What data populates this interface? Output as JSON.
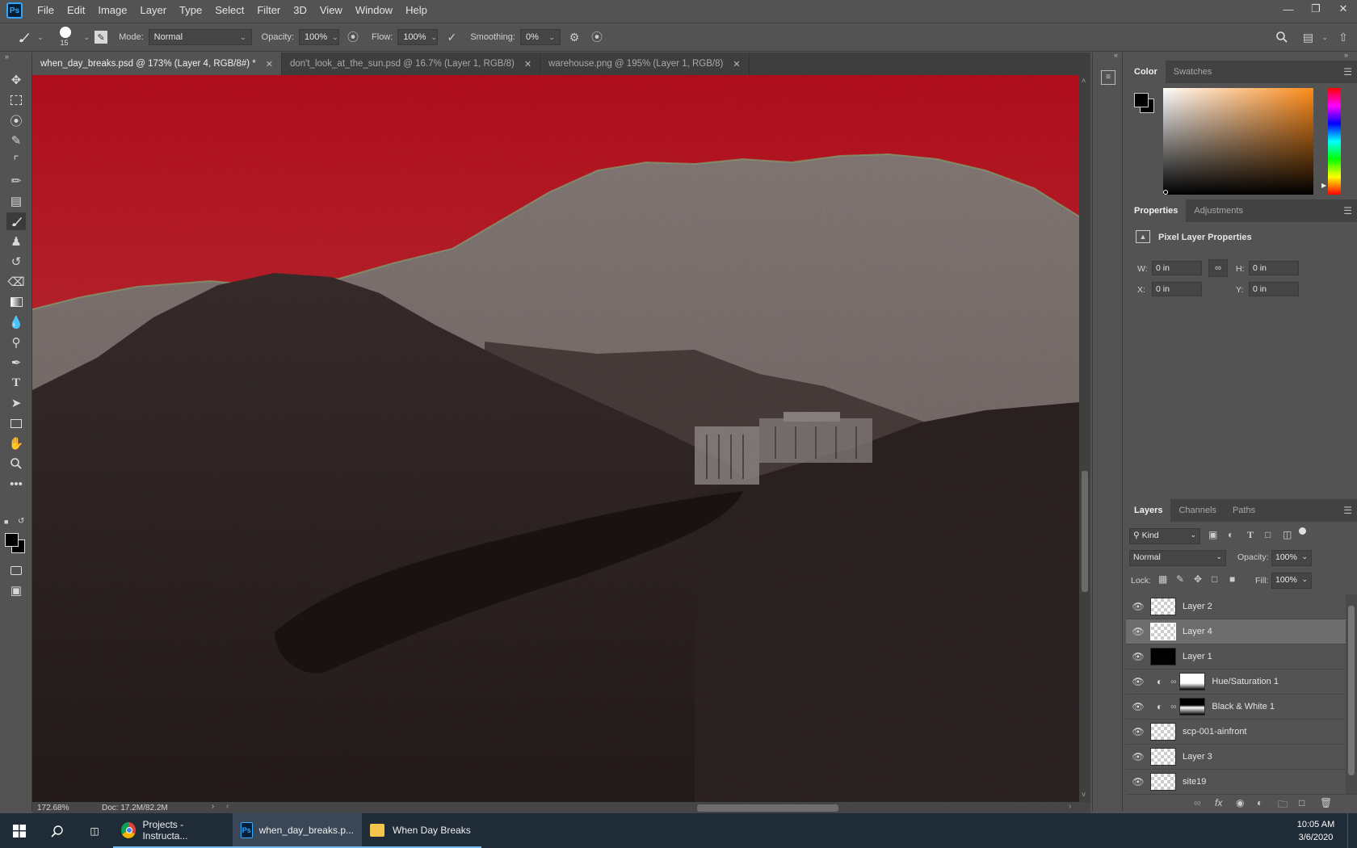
{
  "app": {
    "name": "Photoshop",
    "logo_text": "Ps"
  },
  "menu": [
    "File",
    "Edit",
    "Image",
    "Layer",
    "Type",
    "Select",
    "Filter",
    "3D",
    "View",
    "Window",
    "Help"
  ],
  "options": {
    "brush_size": "15",
    "mode_label": "Mode:",
    "mode_value": "Normal",
    "opacity_label": "Opacity:",
    "opacity_value": "100%",
    "flow_label": "Flow:",
    "flow_value": "100%",
    "smoothing_label": "Smoothing:",
    "smoothing_value": "0%"
  },
  "tabs": [
    {
      "label": "when_day_breaks.psd @ 173% (Layer 4, RGB/8#) *",
      "active": true
    },
    {
      "label": "don't_look_at_the_sun.psd @ 16.7% (Layer 1, RGB/8)",
      "active": false
    },
    {
      "label": "warehouse.png @ 195% (Layer 1, RGB/8)",
      "active": false
    }
  ],
  "status": {
    "zoom": "172.68%",
    "doc": "Doc: 17.2M/82.2M"
  },
  "color_panel": {
    "tabs": [
      "Color",
      "Swatches"
    ]
  },
  "properties_panel": {
    "tabs": [
      "Properties",
      "Adjustments"
    ],
    "title": "Pixel Layer Properties",
    "w_label": "W:",
    "w_value": "0 in",
    "h_label": "H:",
    "h_value": "0 in",
    "x_label": "X:",
    "x_value": "0 in",
    "y_label": "Y:",
    "y_value": "0 in"
  },
  "layers_panel": {
    "tabs": [
      "Layers",
      "Channels",
      "Paths"
    ],
    "filter_value": "Kind",
    "blend_mode": "Normal",
    "opacity_label": "Opacity:",
    "opacity_value": "100%",
    "lock_label": "Lock:",
    "fill_label": "Fill:",
    "fill_value": "100%",
    "layers": [
      {
        "name": "Layer 2",
        "kind": "pixel",
        "selected": false
      },
      {
        "name": "Layer 4",
        "kind": "pixel",
        "selected": true
      },
      {
        "name": "Layer 1",
        "kind": "black",
        "selected": false
      },
      {
        "name": "Hue/Saturation 1",
        "kind": "adjustment",
        "selected": false
      },
      {
        "name": "Black & White 1",
        "kind": "adjustment",
        "selected": false
      },
      {
        "name": "scp-001-ainfront",
        "kind": "pixel",
        "selected": false
      },
      {
        "name": "Layer 3",
        "kind": "pixel",
        "selected": false
      },
      {
        "name": "site19",
        "kind": "pixel",
        "selected": false
      }
    ]
  },
  "taskbar": {
    "apps": [
      {
        "label": "Projects - Instructa...",
        "icon": "chrome-icon"
      },
      {
        "label": "when_day_breaks.p...",
        "icon": "photoshop-icon"
      },
      {
        "label": "When Day Breaks",
        "icon": "folder-icon"
      }
    ],
    "time": "10:05 AM",
    "date": "3/6/2020"
  },
  "colors": {
    "accent": "#31a8ff",
    "sky": "#c0121f",
    "ui_bg": "#535353"
  }
}
